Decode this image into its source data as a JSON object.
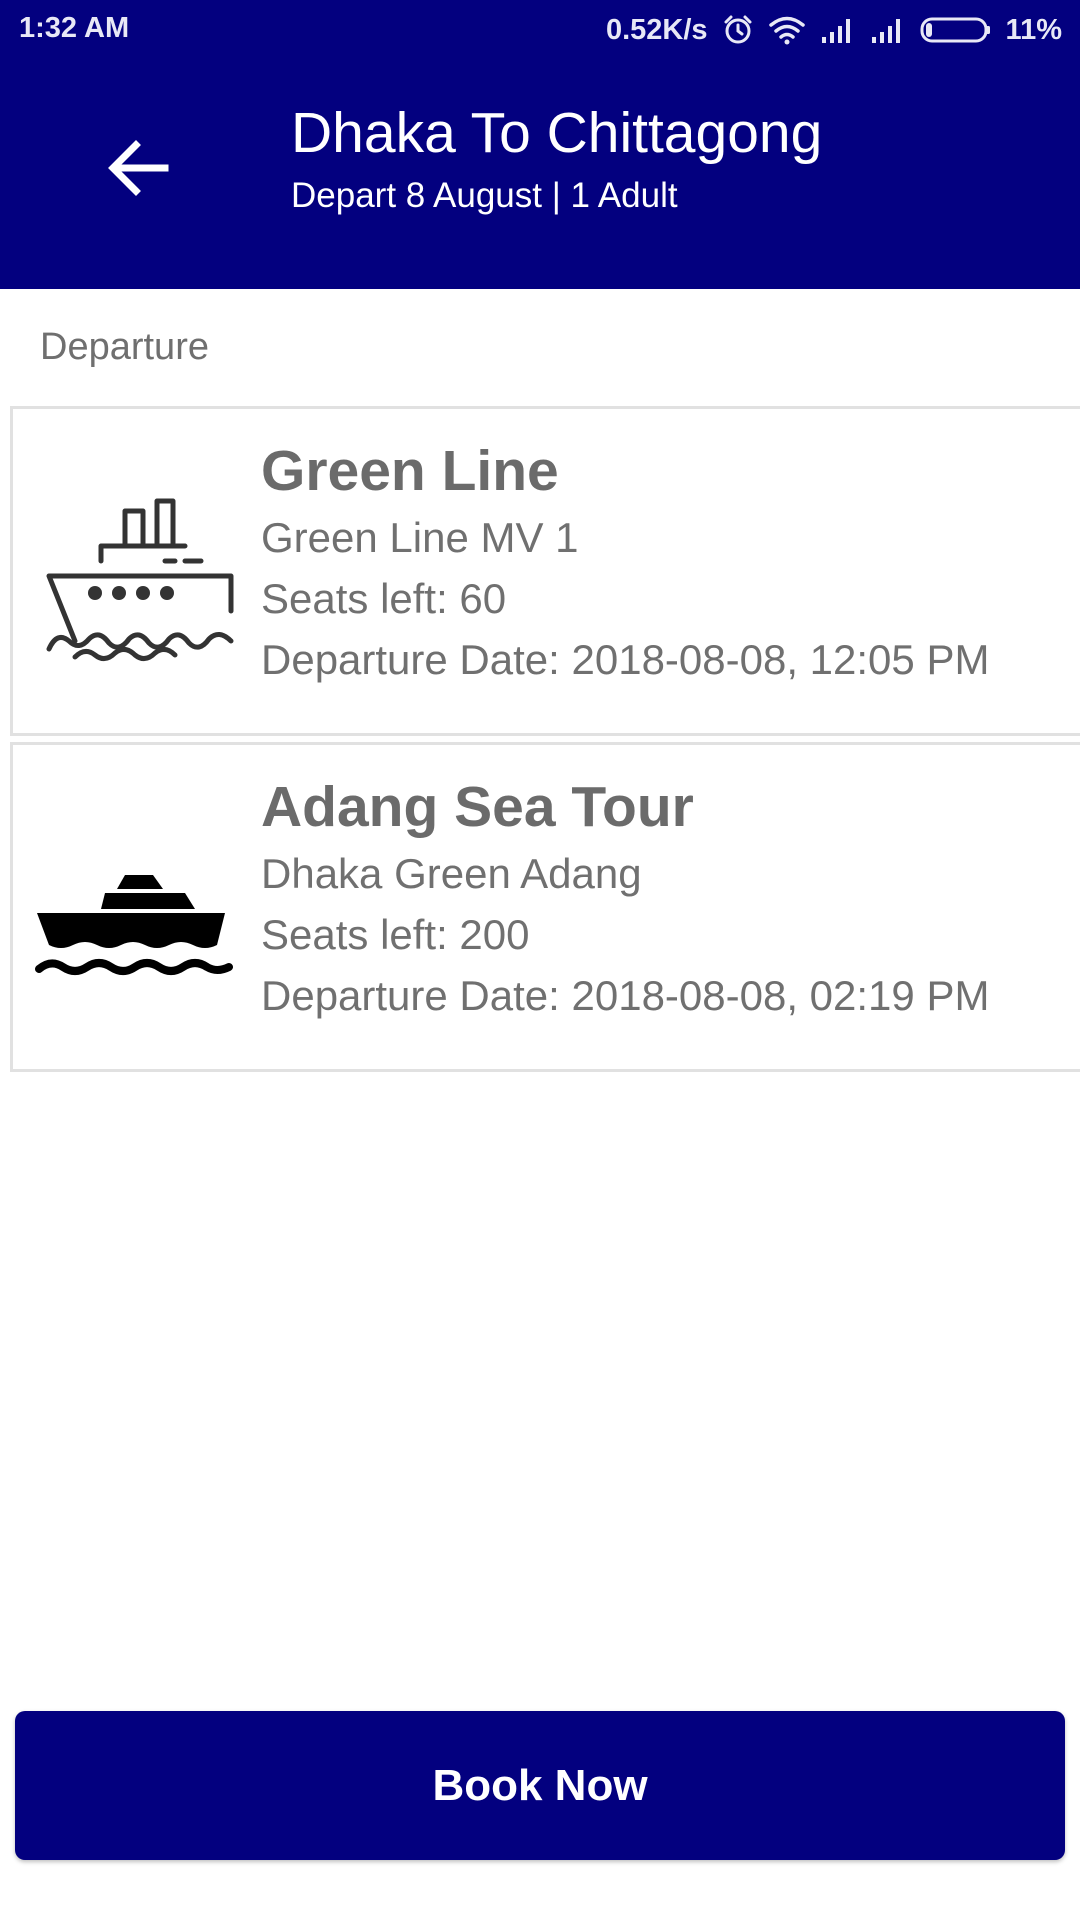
{
  "status_bar": {
    "time": "1:32 AM",
    "network_speed": "0.52K/s",
    "battery": "11%",
    "icons": [
      "alarm-icon",
      "wifi-icon",
      "signal-icon",
      "signal-icon",
      "battery-icon"
    ]
  },
  "header": {
    "title": "Dhaka To Chittagong",
    "subtitle": "Depart 8 August | 1 Adult",
    "back_icon": "arrow-left-icon",
    "background_color": "#03007f"
  },
  "section": {
    "label": "Departure"
  },
  "trips": [
    {
      "operator": "Green Line",
      "vessel": "Green Line MV 1",
      "seats": "Seats left: 60",
      "departure": "Departure Date: 2018-08-08, 12:05 PM",
      "icon": "ship-outline-icon"
    },
    {
      "operator": "Adang Sea Tour",
      "vessel": "Dhaka Green Adang",
      "seats": "Seats left: 200",
      "departure": "Departure Date: 2018-08-08, 02:19 PM",
      "icon": "ship-solid-icon"
    }
  ],
  "actions": {
    "book_label": "Book Now",
    "button_color": "#03007f"
  }
}
